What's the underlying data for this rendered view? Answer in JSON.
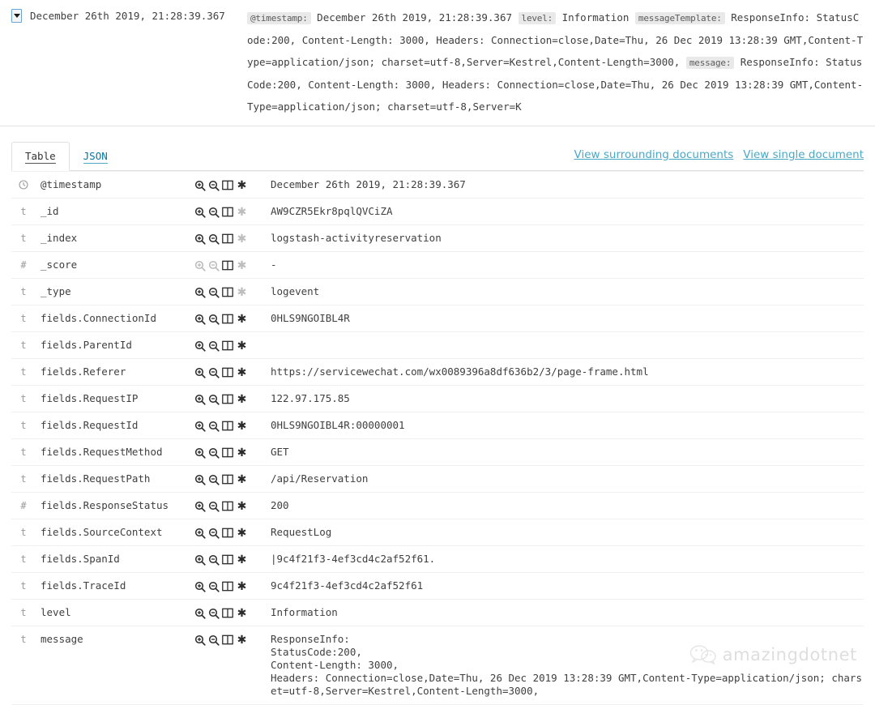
{
  "header": {
    "toggle_icon": "caret-down-icon",
    "timestamp": "December 26th 2019, 21:28:39.367",
    "summary_parts": [
      {
        "key": "@timestamp:",
        "value": "December 26th 2019, 21:28:39.367 "
      },
      {
        "key": "level:",
        "value": "Information "
      },
      {
        "key": "messageTemplate:",
        "value": "ResponseInfo: StatusCode:200, Content-Length: 3000, Headers: Connection=close,Date=Thu, 26 Dec 2019 13:28:39 GMT,Content-Type=application/json; charset=utf-8,Server=Kestrel,Content-Length=3000, "
      },
      {
        "key": "message:",
        "value": "ResponseInfo: StatusCode:200, Content-Length: 3000, Headers: Connection=close,Date=Thu, 26 Dec 2019 13:28:39 GMT,Content-Type=application/json; charset=utf-8,Server=K"
      }
    ]
  },
  "tabs": [
    {
      "label": "Table",
      "active": true
    },
    {
      "label": "JSON",
      "active": false
    }
  ],
  "links": [
    {
      "label": "View surrounding documents"
    },
    {
      "label": "View single document"
    }
  ],
  "actions": {
    "filter_for_value": "magnify-plus-icon",
    "filter_out_value": "magnify-minus-icon",
    "toggle_column": "table-column-icon",
    "filter_field_exists": "asterisk-icon"
  },
  "colors": {
    "link": "#4aa8c7",
    "text": "#3f3f3f",
    "muted": "#9a9a9a",
    "row_border": "#f0f0f0",
    "key_badge_bg": "#e9e9e9",
    "toggle_border": "#6aa3d5"
  },
  "rows": [
    {
      "type": "date",
      "type_glyph": "clock-icon",
      "name": "@timestamp",
      "value": "December 26th 2019, 21:28:39.367",
      "actions_enabled": true,
      "star_enabled": true
    },
    {
      "type": "string",
      "type_glyph": "t",
      "name": "_id",
      "value": "AW9CZR5Ekr8pqlQVCiZA",
      "actions_enabled": true,
      "star_enabled": false
    },
    {
      "type": "string",
      "type_glyph": "t",
      "name": "_index",
      "value": "logstash-activityreservation",
      "actions_enabled": true,
      "star_enabled": false
    },
    {
      "type": "number",
      "type_glyph": "#",
      "name": "_score",
      "value": "-",
      "actions_enabled": false,
      "star_enabled": false
    },
    {
      "type": "string",
      "type_glyph": "t",
      "name": "_type",
      "value": "logevent",
      "actions_enabled": true,
      "star_enabled": false
    },
    {
      "type": "string",
      "type_glyph": "t",
      "name": "fields.ConnectionId",
      "value": "0HLS9NGOIBL4R",
      "actions_enabled": true,
      "star_enabled": true
    },
    {
      "type": "string",
      "type_glyph": "t",
      "name": "fields.ParentId",
      "value": "",
      "actions_enabled": true,
      "star_enabled": true
    },
    {
      "type": "string",
      "type_glyph": "t",
      "name": "fields.Referer",
      "value": "https://servicewechat.com/wx0089396a8df636b2/3/page-frame.html",
      "actions_enabled": true,
      "star_enabled": true
    },
    {
      "type": "string",
      "type_glyph": "t",
      "name": "fields.RequestIP",
      "value": "122.97.175.85",
      "actions_enabled": true,
      "star_enabled": true
    },
    {
      "type": "string",
      "type_glyph": "t",
      "name": "fields.RequestId",
      "value": "0HLS9NGOIBL4R:00000001",
      "actions_enabled": true,
      "star_enabled": true
    },
    {
      "type": "string",
      "type_glyph": "t",
      "name": "fields.RequestMethod",
      "value": "GET",
      "actions_enabled": true,
      "star_enabled": true
    },
    {
      "type": "string",
      "type_glyph": "t",
      "name": "fields.RequestPath",
      "value": "/api/Reservation",
      "actions_enabled": true,
      "star_enabled": true
    },
    {
      "type": "number",
      "type_glyph": "#",
      "name": "fields.ResponseStatus",
      "value": "200",
      "actions_enabled": true,
      "star_enabled": true
    },
    {
      "type": "string",
      "type_glyph": "t",
      "name": "fields.SourceContext",
      "value": "RequestLog",
      "actions_enabled": true,
      "star_enabled": true
    },
    {
      "type": "string",
      "type_glyph": "t",
      "name": "fields.SpanId",
      "value": "|9c4f21f3-4ef3cd4c2af52f61.",
      "actions_enabled": true,
      "star_enabled": true
    },
    {
      "type": "string",
      "type_glyph": "t",
      "name": "fields.TraceId",
      "value": "9c4f21f3-4ef3cd4c2af52f61",
      "actions_enabled": true,
      "star_enabled": true
    },
    {
      "type": "string",
      "type_glyph": "t",
      "name": "level",
      "value": "Information",
      "actions_enabled": true,
      "star_enabled": true
    },
    {
      "type": "string",
      "type_glyph": "t",
      "name": "message",
      "value": "ResponseInfo:\nStatusCode:200,\nContent-Length: 3000,\nHeaders: Connection=close,Date=Thu, 26 Dec 2019 13:28:39 GMT,Content-Type=application/json; charset=utf-8,Server=Kestrel,Content-Length=3000,",
      "actions_enabled": true,
      "star_enabled": true
    }
  ],
  "watermark": {
    "icon": "wechat-icon",
    "text": "amazingdotnet"
  }
}
